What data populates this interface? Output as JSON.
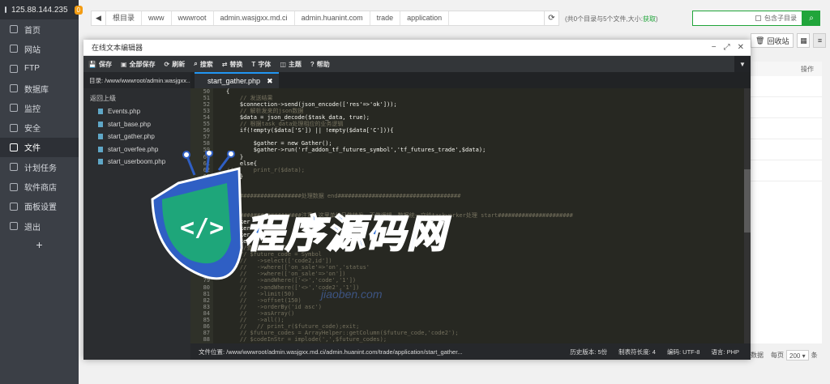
{
  "server": {
    "ip": "125.88.144.235",
    "badge": "0"
  },
  "sidebar": {
    "items": [
      {
        "label": "首页",
        "icon": "home-icon"
      },
      {
        "label": "网站",
        "icon": "globe-icon"
      },
      {
        "label": "FTP",
        "icon": "ftp-icon"
      },
      {
        "label": "数据库",
        "icon": "database-icon"
      },
      {
        "label": "监控",
        "icon": "monitor-icon"
      },
      {
        "label": "安全",
        "icon": "shield-icon"
      },
      {
        "label": "文件",
        "icon": "folder-icon",
        "active": true
      },
      {
        "label": "计划任务",
        "icon": "calendar-icon"
      },
      {
        "label": "软件商店",
        "icon": "store-icon"
      },
      {
        "label": "面板设置",
        "icon": "settings-icon"
      },
      {
        "label": "退出",
        "icon": "logout-icon"
      }
    ],
    "add": "+"
  },
  "breadcrumb": [
    "根目录",
    "www",
    "wwwroot",
    "admin.wasjgxx.md.ci",
    "admin.huanint.com",
    "trade",
    "application"
  ],
  "dir_info": {
    "text": "(共0个目录与5个文件,大小:",
    "link": "获取",
    "close": ")"
  },
  "search": {
    "subdir_label": "包含子目录"
  },
  "toolbar_right": {
    "recycle": "回收站"
  },
  "table": {
    "ops_header": "操作"
  },
  "pagination": {
    "per_page_label": "每页",
    "per_page_value": "200",
    "unit": "条",
    "items_label": "数据"
  },
  "editor": {
    "title": "在线文本编辑器",
    "toolbar": [
      {
        "label": "保存",
        "icon": "save-icon"
      },
      {
        "label": "全部保存",
        "icon": "save-all-icon"
      },
      {
        "label": "刷新",
        "icon": "refresh-icon"
      },
      {
        "label": "搜索",
        "icon": "search-icon"
      },
      {
        "label": "替换",
        "icon": "replace-icon"
      },
      {
        "label": "字体",
        "icon": "font-icon"
      },
      {
        "label": "主题",
        "icon": "theme-icon"
      },
      {
        "label": "帮助",
        "icon": "help-icon"
      }
    ],
    "dir_label": "目录: /www/wwwroot/admin.wasjgxx...",
    "up_label": "返回上级",
    "files": [
      "Events.php",
      "start_base.php",
      "start_gather.php",
      "start_overfee.php",
      "start_userboom.php"
    ],
    "active_tab": "start_gather.php",
    "code_lines": [
      {
        "n": "50",
        "t": "{",
        "c": "kw"
      },
      {
        "n": "51",
        "t": "    // 发送结果",
        "c": "comment"
      },
      {
        "n": "52",
        "t": "    $connection->send(json_encode(['res'=>'ok']));",
        "c": "kw"
      },
      {
        "n": "53",
        "t": "    // 解析发来的json数据",
        "c": "comment"
      },
      {
        "n": "54",
        "t": "    $data = json_decode($task_data, true);",
        "c": "kw"
      },
      {
        "n": "55",
        "t": "    // 根据task_data处理相应的业务逻辑",
        "c": "comment"
      },
      {
        "n": "56",
        "t": "    if(!empty($data['S']) || !empty($data['C'])){",
        "c": "kw"
      },
      {
        "n": "57",
        "t": "",
        "c": "kw"
      },
      {
        "n": "58",
        "t": "        $gather = new Gather();",
        "c": "kw"
      },
      {
        "n": "59",
        "t": "        $gather->run('rf_addon_tf_futures_symbol','tf_futures_trade',$data);",
        "c": "kw"
      },
      {
        "n": "60",
        "t": "    }",
        "c": "kw"
      },
      {
        "n": "61",
        "t": "    else{",
        "c": "kw"
      },
      {
        "n": "62",
        "t": "//      print_r($data);",
        "c": "comment"
      },
      {
        "n": "63",
        "t": "    }",
        "c": "kw"
      },
      {
        "n": "64",
        "t": "",
        "c": "kw"
      },
      {
        "n": "65",
        "t": "",
        "c": "kw"
      },
      {
        "n": "66",
        "t": "//####################处理数据 end####################################",
        "c": "comment"
      },
      {
        "n": "67",
        "t": "",
        "c": "kw"
      },
      {
        "n": "68",
        "t": "",
        "c": "kw"
      },
      {
        "n": "69",
        "t": "//####################注意，这里单纯只做转发，不做逻辑，数据统一交给taskworker处理 start######################",
        "c": "comment"
      },
      {
        "n": "70",
        "t": "$worker",
        "c": "kw"
      },
      {
        "n": "71",
        "t": "$worker",
        "c": "kw"
      },
      {
        "n": "72",
        "t": "$worker",
        "c": "kw"
      },
      {
        "n": "73",
        "t": "$worker",
        "c": "kw"
      },
      {
        "n": "74",
        "t": "    //查询所有有效的",
        "c": "comment"
      },
      {
        "n": "75",
        "t": "    // $future_code = Symbol",
        "c": "comment"
      },
      {
        "n": "76",
        "t": "    //   ->select(['code2,id'])",
        "c": "comment"
      },
      {
        "n": "77",
        "t": "    //   ->where(['on_sale'=>'on','status'",
        "c": "comment"
      },
      {
        "n": "78",
        "t": "    //   ->where(['on_sale'=>'on'])",
        "c": "comment"
      },
      {
        "n": "79",
        "t": "    //   ->andWhere(['<>','code','1'])",
        "c": "comment"
      },
      {
        "n": "80",
        "t": "    //   ->andWhere(['<>','code2','1'])",
        "c": "comment"
      },
      {
        "n": "81",
        "t": "    //   ->limit(50)",
        "c": "comment"
      },
      {
        "n": "82",
        "t": "    //   ->offset(150)",
        "c": "comment"
      },
      {
        "n": "83",
        "t": "    //   ->orderBy('id asc')",
        "c": "comment"
      },
      {
        "n": "84",
        "t": "    //   ->asArray()",
        "c": "comment"
      },
      {
        "n": "85",
        "t": "    //   ->all();",
        "c": "comment"
      },
      {
        "n": "86",
        "t": "    //   // print_r($future_code);exit;",
        "c": "comment"
      },
      {
        "n": "87",
        "t": "    // $future_codes = ArrayHelper::getColumn($future_code,'code2');",
        "c": "comment"
      },
      {
        "n": "88",
        "t": "    // $codeInStr = implode(',',$future_codes);",
        "c": "comment"
      }
    ],
    "status": {
      "path": "文件位置: /www/wwwroot/admin.wasjgxx.md.ci/admin.huanint.com/trade/application/start_gather...",
      "history": "历史版本: 5份",
      "indent": "制表符长度: 4",
      "encoding": "编码: UTF-8",
      "lang": "语言: PHP"
    }
  },
  "watermark": {
    "text": "程序源码网",
    "url": "jiaoben.com"
  },
  "colors": {
    "sidebar_bg": "#3b3f46",
    "accent_green": "#20a53a",
    "editor_bg": "#272822",
    "tab_accent": "#2196f3",
    "watermark_blue": "#2d6fd8"
  }
}
